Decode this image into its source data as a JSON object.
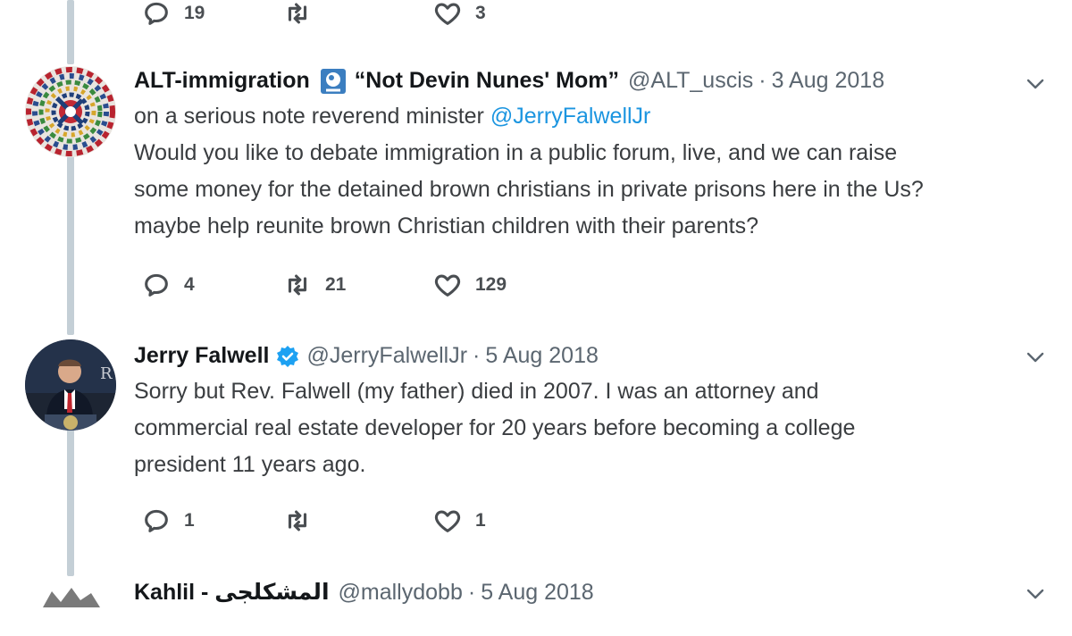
{
  "top_actions": {
    "replies": "19",
    "retweets": "",
    "likes": "3"
  },
  "tweets": [
    {
      "display_name": "ALT-immigration",
      "emoji_icon": "crystal-ball-emoji-icon",
      "display_name_suffix": "“Not Devin Nunes' Mom”",
      "handle": "@ALT_uscis",
      "date": "3 Aug 2018",
      "line1_prefix": "on a serious note reverend minister ",
      "line1_mention": "@JerryFalwellJr",
      "body_rest": "Would you like to debate immigration in a public forum, live, and we can raise\nsome money for the detained brown christians in private prisons here in the Us?\nmaybe help reunite brown Christian children with their parents?",
      "replies": "4",
      "retweets": "21",
      "likes": "129"
    },
    {
      "display_name": "Jerry Falwell",
      "verified_icon": "verified-badge-icon",
      "handle": "@JerryFalwellJr",
      "date": "5 Aug 2018",
      "body": "Sorry but Rev. Falwell (my father) died in 2007.  I was an attorney and\ncommercial real estate developer for 20 years before becoming a college\npresident 11 years ago.",
      "replies": "1",
      "retweets": "",
      "likes": "1"
    },
    {
      "display_name": "Kahlil - المشكلجى",
      "handle": "@mallydobb",
      "date": "5 Aug 2018"
    }
  ],
  "colors": {
    "link": "#1b95e0",
    "thread_line": "#c4cfd6",
    "verified": "#1da1f2",
    "text": "#14171a",
    "muted": "#5b6670"
  }
}
